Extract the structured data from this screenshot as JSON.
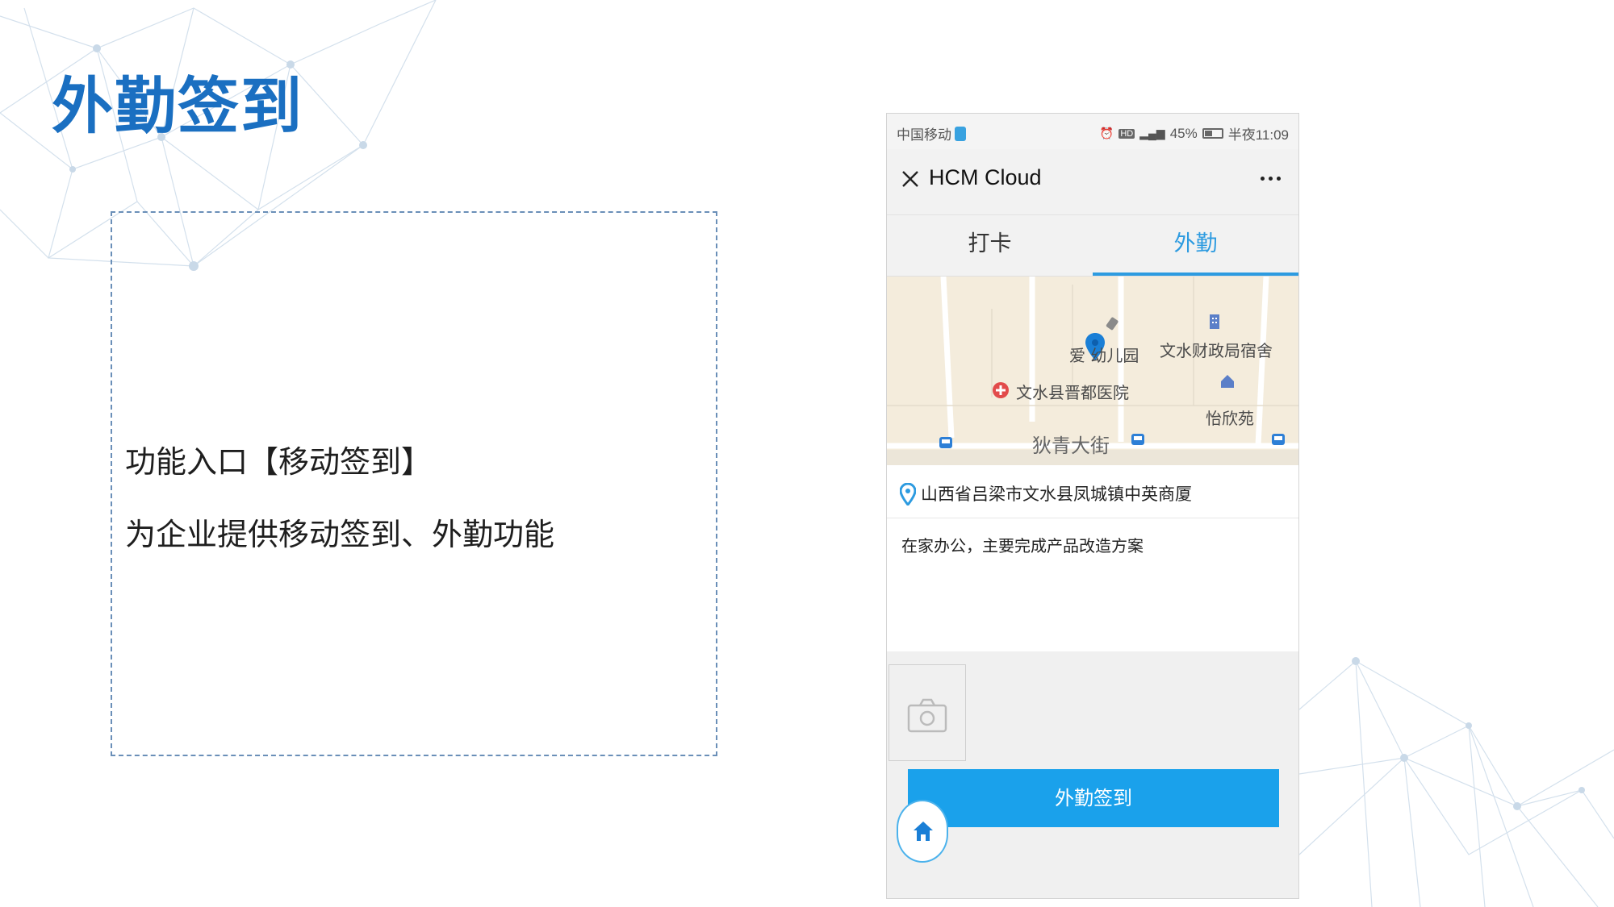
{
  "slide": {
    "title": "外勤签到",
    "desc_line1": "功能入口【移动签到】",
    "desc_line2": "为企业提供移动签到、外勤功能"
  },
  "phone": {
    "status_bar": {
      "carrier": "中国移动",
      "network": "⁴ᴳ",
      "battery_percent": "45%",
      "time": "半夜11:09"
    },
    "nav": {
      "title": "HCM Cloud"
    },
    "tabs": [
      {
        "label": "打卡",
        "active": false
      },
      {
        "label": "外勤",
        "active": true
      }
    ],
    "map": {
      "labels": {
        "kindergarten": "爱 幼儿园",
        "finance_dorm": "文水财政局宿舍",
        "hospital": "文水县晋都医院",
        "yixinyuan": "怡欣苑",
        "street": "狄青大街"
      }
    },
    "address": "山西省吕梁市文水县凤城镇中英商厦",
    "note": "在家办公，主要完成产品改造方案",
    "signin_button_label": "外勤签到"
  },
  "colors": {
    "title_blue": "#1a6fc1",
    "accent_blue": "#2d9be0",
    "button_blue": "#1aa1eb"
  }
}
